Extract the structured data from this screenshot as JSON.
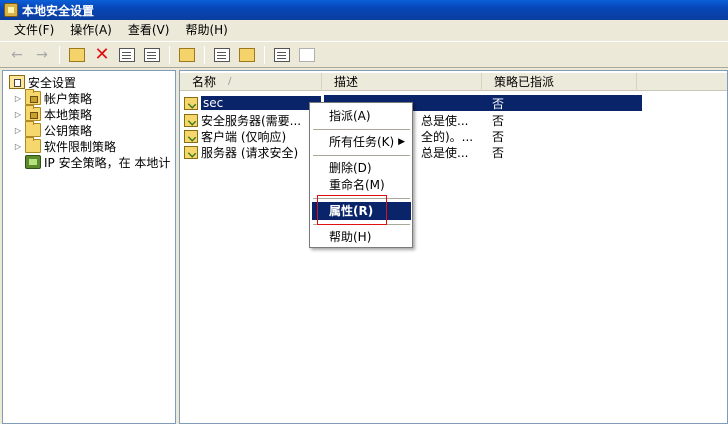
{
  "window": {
    "title": "本地安全设置"
  },
  "menubar": {
    "items": [
      "文件(F)",
      "操作(A)",
      "查看(V)",
      "帮助(H)"
    ]
  },
  "toolbar": {
    "buttons": [
      "back-icon",
      "forward-icon",
      "up-folder-icon",
      "delete-icon",
      "properties-icon",
      "export-icon",
      "help-icon",
      "create-policy-icon",
      "manage-filters-icon",
      "assign-icon",
      "unassign-icon"
    ]
  },
  "tree": {
    "root": "安全设置",
    "items": [
      {
        "label": "帐户策略",
        "icon": "folder-lock-icon"
      },
      {
        "label": "本地策略",
        "icon": "folder-lock-icon"
      },
      {
        "label": "公钥策略",
        "icon": "folder-icon"
      },
      {
        "label": "软件限制策略",
        "icon": "folder-icon"
      },
      {
        "label": "IP 安全策略，在 本地计",
        "icon": "ipsec-icon"
      }
    ]
  },
  "list": {
    "columns": [
      "名称",
      "描述",
      "策略已指派"
    ],
    "sort_indicator": "/",
    "rows": [
      {
        "name": "sec",
        "description": "",
        "assigned": "否"
      },
      {
        "name": "安全服务器(需要...",
        "description": "总是使...",
        "assigned": "否"
      },
      {
        "name": "客户端 (仅响应)",
        "description": "全的)。...",
        "assigned": "否"
      },
      {
        "name": "服务器 (请求安全)",
        "description": "总是使...",
        "assigned": "否"
      }
    ]
  },
  "context_menu": {
    "items": [
      {
        "label": "指派(A)"
      },
      {
        "label": "所有任务(K)",
        "submenu": true
      },
      {
        "label": "删除(D)"
      },
      {
        "label": "重命名(M)"
      },
      {
        "label": "属性(R)",
        "selected": true
      },
      {
        "label": "帮助(H)"
      }
    ]
  },
  "colors": {
    "selection": "#0a246a",
    "titlebar": "#0a5fd8",
    "highlight_box": "#e01010"
  }
}
